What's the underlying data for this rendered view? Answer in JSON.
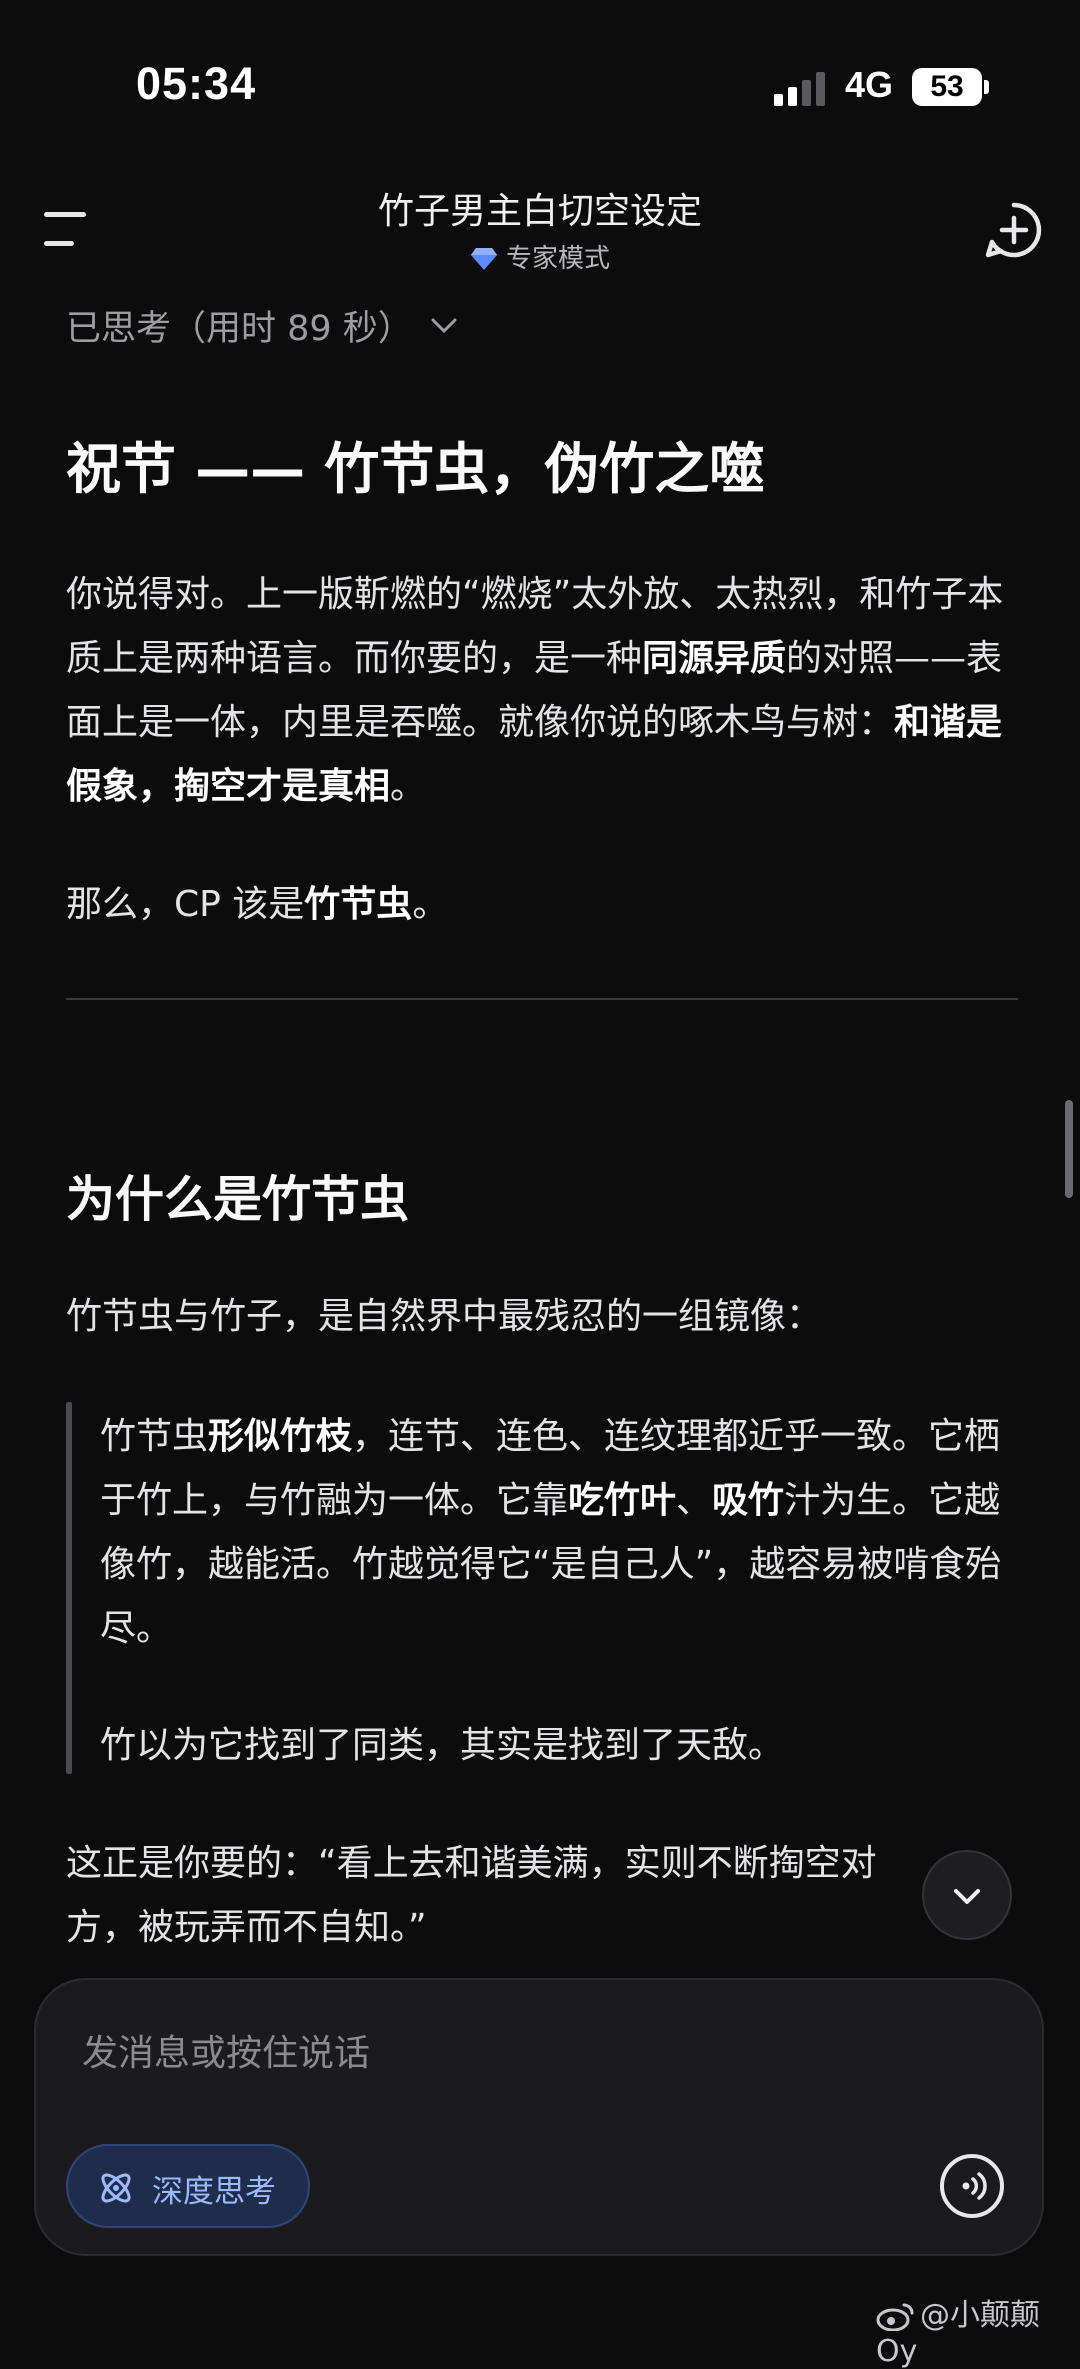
{
  "status_bar": {
    "time": "05:34",
    "network": "4G",
    "battery": "53"
  },
  "header": {
    "title": "竹子男主白切空设定",
    "mode": "专家模式",
    "icons": [
      "menu-icon",
      "new-chat-icon"
    ]
  },
  "thought": {
    "label": "已思考（用时 89 秒）"
  },
  "sections": [
    {
      "heading": "祝节 —— 竹节虫，伪竹之噬",
      "para1": {
        "a": "你说得对。上一版靳燃的“燃烧”太外放、太热烈，和竹子本质上是两种语言。而你要的，是一种",
        "b": "同源异质",
        "c": "的对照——表面上是一体，内里是吞噬。就像你说的啄木鸟与树：",
        "d": "和谐是假象，掏空才是真相",
        "e": "。"
      },
      "para2": {
        "a": "那么，CP 该是",
        "b": "竹节虫",
        "c": "。"
      }
    },
    {
      "heading": "为什么是竹节虫",
      "intro": "竹节虫与竹子，是自然界中最残忍的一组镜像：",
      "quote1": {
        "a": "竹节虫",
        "b": "形似竹枝",
        "c": "，连节、连色、连纹理都近乎一致。它栖于竹上，与竹融为一体。它靠",
        "d": "吃竹叶",
        "e": "、",
        "f": "吸竹",
        "g": "汁为生。它越像竹，越能活。竹越觉得它“是自己人”，越容易被啃食殆尽。"
      },
      "quote2": "竹以为它找到了同类，其实是找到了天敌。",
      "outro": "这正是你要的：“看上去和谐美满，实则不断掏空对方，被玩弄而不自知。”"
    }
  ],
  "composer": {
    "placeholder": "发消息或按住说话",
    "deep_think_label": "深度思考"
  },
  "watermark": "@小颠颠Oy"
}
